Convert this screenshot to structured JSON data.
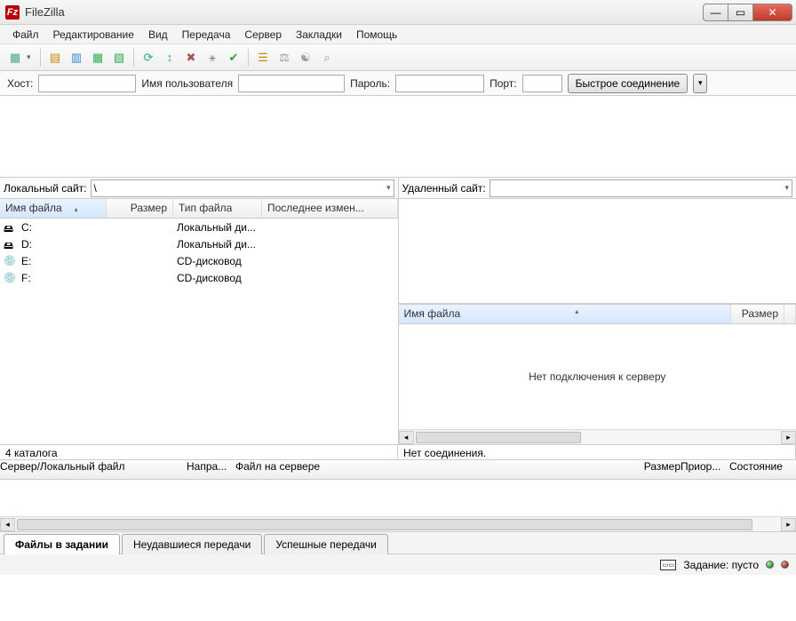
{
  "window": {
    "title": "FileZilla"
  },
  "menu": {
    "items": [
      "Файл",
      "Редактирование",
      "Вид",
      "Передача",
      "Сервер",
      "Закладки",
      "Помощь"
    ]
  },
  "quickconnect": {
    "host_label": "Хост:",
    "host_value": "",
    "user_label": "Имя пользователя",
    "user_value": "",
    "pass_label": "Пароль:",
    "pass_value": "",
    "port_label": "Порт:",
    "port_value": "",
    "connect_label": "Быстрое соединение"
  },
  "local": {
    "site_label": "Локальный сайт:",
    "site_value": "\\",
    "columns": {
      "name": "Имя файла",
      "size": "Размер",
      "type": "Тип файла",
      "modified": "Последнее измен..."
    },
    "rows": [
      {
        "name": "C:",
        "type": "Локальный ди...",
        "icon": "drive"
      },
      {
        "name": "D:",
        "type": "Локальный ди...",
        "icon": "drive"
      },
      {
        "name": "E:",
        "type": "CD-дисковод",
        "icon": "cd"
      },
      {
        "name": "F:",
        "type": "CD-дисковод",
        "icon": "cd"
      }
    ],
    "summary": "4 каталога"
  },
  "remote": {
    "site_label": "Удаленный сайт:",
    "site_value": "",
    "columns": {
      "name": "Имя файла",
      "size": "Размер"
    },
    "empty_message": "Нет подключения к серверу",
    "summary": "Нет соединения."
  },
  "queue": {
    "columns": {
      "server": "Сервер/Локальный файл",
      "direction": "Напра...",
      "remote": "Файл на сервере",
      "size": "Размер",
      "priority": "Приор...",
      "status": "Состояние"
    },
    "tabs": {
      "queued": "Файлы в задании",
      "failed": "Неудавшиеся передачи",
      "successful": "Успешные передачи"
    }
  },
  "statusbar": {
    "queue_label": "Задание: пусто"
  }
}
